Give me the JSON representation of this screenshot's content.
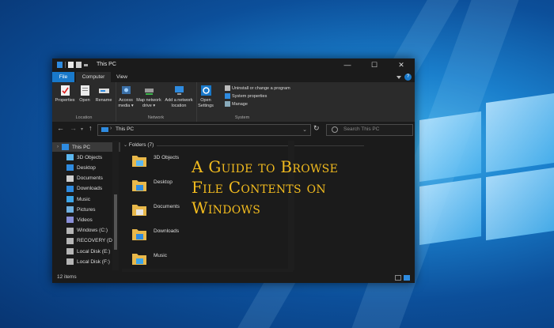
{
  "window": {
    "title": "This PC",
    "controls": {
      "minimize": "—",
      "maximize": "☐",
      "close": "✕"
    }
  },
  "tabs": [
    {
      "label": "File",
      "active": false
    },
    {
      "label": "Computer",
      "active": true
    },
    {
      "label": "View",
      "active": false
    }
  ],
  "ribbon": {
    "location": {
      "label": "Location",
      "buttons": [
        "Properties",
        "Open",
        "Rename"
      ]
    },
    "network": {
      "label": "Network",
      "buttons": [
        [
          "Access",
          "media ▾"
        ],
        [
          "Map network",
          "drive ▾"
        ],
        [
          "Add a network",
          "location"
        ]
      ]
    },
    "system": {
      "label": "System",
      "open_settings": [
        "Open",
        "Settings"
      ],
      "items": [
        "Uninstall or change a program",
        "System properties",
        "Manage"
      ]
    }
  },
  "address": {
    "path": "This PC",
    "search_placeholder": "Search This PC"
  },
  "sidebar": {
    "items": [
      {
        "label": "This PC",
        "icon": "pc-icon",
        "selected": true
      },
      {
        "label": "3D Objects",
        "icon": "3d-objects-icon",
        "selected": false
      },
      {
        "label": "Desktop",
        "icon": "desktop-icon",
        "selected": false
      },
      {
        "label": "Documents",
        "icon": "documents-icon",
        "selected": false
      },
      {
        "label": "Downloads",
        "icon": "downloads-icon",
        "selected": false
      },
      {
        "label": "Music",
        "icon": "music-icon",
        "selected": false
      },
      {
        "label": "Pictures",
        "icon": "pictures-icon",
        "selected": false
      },
      {
        "label": "Videos",
        "icon": "videos-icon",
        "selected": false
      },
      {
        "label": "Windows (C:)",
        "icon": "drive-icon",
        "selected": false
      },
      {
        "label": "RECOVERY (D:)",
        "icon": "drive-icon",
        "selected": false
      },
      {
        "label": "Local Disk (E:)",
        "icon": "drive-icon",
        "selected": false
      },
      {
        "label": "Local Disk (F:)",
        "icon": "drive-icon",
        "selected": false
      }
    ]
  },
  "content": {
    "group_header": "Folders (7)",
    "folders": [
      "3D Objects",
      "Desktop",
      "Documents",
      "Downloads",
      "Music"
    ]
  },
  "overlay_text": [
    "A Guide to Browse",
    "File Contents on",
    "Windows"
  ],
  "status": {
    "item_count": "12 items"
  },
  "colors": {
    "accent": "#1979ca",
    "overlay": "#f2bb1e",
    "window_bg": "#1b1b1b",
    "ribbon_bg": "#2b2b2b"
  }
}
